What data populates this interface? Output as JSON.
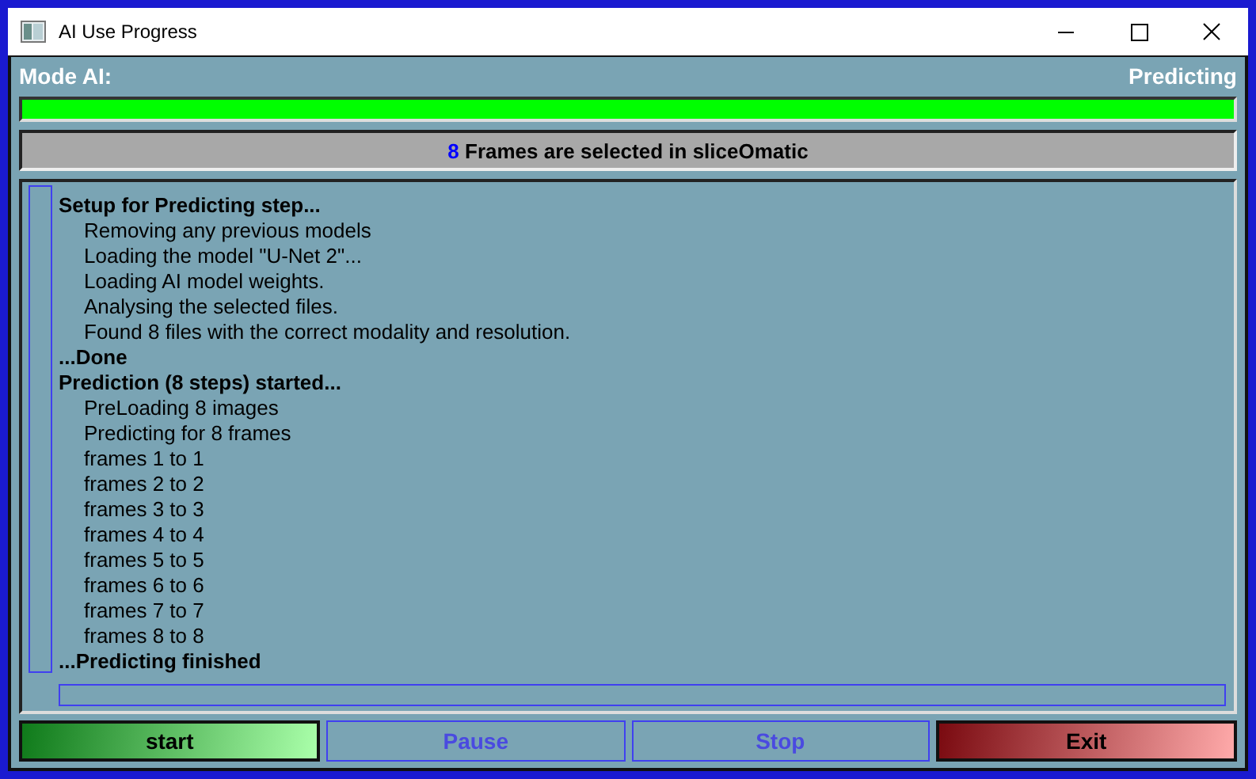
{
  "window": {
    "title": "AI Use Progress"
  },
  "mode": {
    "label": "Mode AI:",
    "value": "Predicting"
  },
  "progress": {
    "level": 1.0
  },
  "banner": {
    "count": "8",
    "text": "Frames are selected in sliceOmatic"
  },
  "log": [
    {
      "kind": "heading",
      "text": "Setup for Predicting step..."
    },
    {
      "kind": "step",
      "text": "Removing any previous models"
    },
    {
      "kind": "step",
      "text": "Loading the model \"U-Net 2\"..."
    },
    {
      "kind": "step",
      "text": "Loading AI model weights."
    },
    {
      "kind": "step",
      "text": "Analysing the selected files."
    },
    {
      "kind": "step",
      "text": "Found 8 files with the correct modality and resolution."
    },
    {
      "kind": "heading",
      "text": "...Done"
    },
    {
      "kind": "heading",
      "text": "Prediction (8 steps) started..."
    },
    {
      "kind": "step",
      "text": "PreLoading 8 images"
    },
    {
      "kind": "step",
      "text": "Predicting for 8 frames"
    },
    {
      "kind": "step",
      "text": "frames 1 to 1"
    },
    {
      "kind": "step",
      "text": "frames 2 to 2"
    },
    {
      "kind": "step",
      "text": "frames 3 to 3"
    },
    {
      "kind": "step",
      "text": "frames 4 to 4"
    },
    {
      "kind": "step",
      "text": "frames 5 to 5"
    },
    {
      "kind": "step",
      "text": "frames 6 to 6"
    },
    {
      "kind": "step",
      "text": "frames 7 to 7"
    },
    {
      "kind": "step",
      "text": "frames 8 to 8"
    },
    {
      "kind": "heading",
      "text": "...Predicting finished"
    }
  ],
  "buttons": [
    {
      "label": "start",
      "kind": "go",
      "disabled": false
    },
    {
      "label": "Pause",
      "kind": "plain",
      "disabled": true
    },
    {
      "label": "Stop",
      "kind": "plain",
      "disabled": true
    },
    {
      "label": "Exit",
      "kind": "quit",
      "disabled": false
    }
  ]
}
